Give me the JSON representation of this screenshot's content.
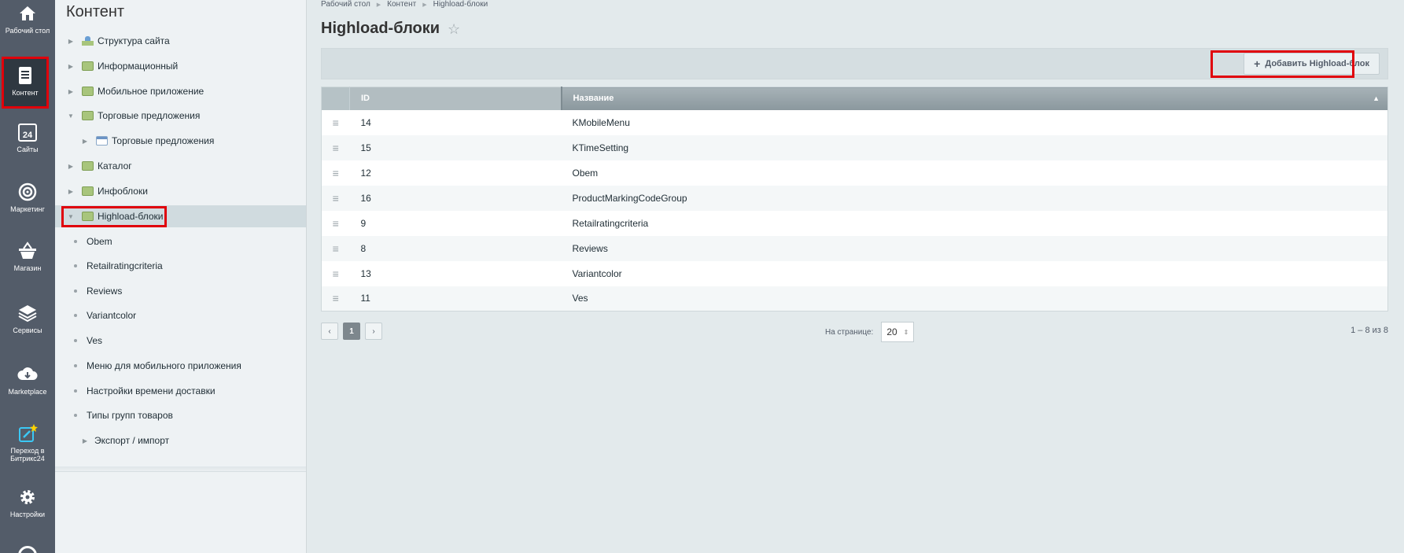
{
  "rail": [
    {
      "label": "Рабочий стол",
      "icon": "home-icon"
    },
    {
      "label": "Контент",
      "icon": "document-icon",
      "active": true
    },
    {
      "label": "Сайты",
      "icon": "calendar-24-icon"
    },
    {
      "label": "Маркетинг",
      "icon": "target-icon"
    },
    {
      "label": "Магазин",
      "icon": "basket-icon"
    },
    {
      "label": "Сервисы",
      "icon": "layers-icon"
    },
    {
      "label": "Marketplace",
      "icon": "cloud-download-icon"
    },
    {
      "label": "Переход в Битрикс24",
      "icon": "edit-star-icon"
    },
    {
      "label": "Настройки",
      "icon": "gear-icon"
    }
  ],
  "tree": {
    "title": "Контент",
    "nodes": [
      {
        "label": "Структура сайта",
        "arrow": "▶",
        "icon": "structure-icon"
      },
      {
        "label": "Информационный",
        "arrow": "▶",
        "icon": "folder-icon"
      },
      {
        "label": "Мобильное приложение",
        "arrow": "▶",
        "icon": "folder-icon"
      },
      {
        "label": "Торговые предложения",
        "arrow": "▼",
        "icon": "folder-icon"
      },
      {
        "label": "Торговые предложения",
        "arrow": "▶",
        "icon": "calendar-icon"
      },
      {
        "label": "Каталог",
        "arrow": "▶",
        "icon": "folder-icon"
      },
      {
        "label": "Инфоблоки",
        "arrow": "▶",
        "icon": "folder-icon"
      },
      {
        "label": "Highload-блоки",
        "arrow": "▼",
        "icon": "folder-icon"
      },
      {
        "label": "Obem"
      },
      {
        "label": "Retailratingcriteria"
      },
      {
        "label": "Reviews"
      },
      {
        "label": "Variantcolor"
      },
      {
        "label": "Ves"
      },
      {
        "label": "Меню для мобильного приложения"
      },
      {
        "label": "Настройки времени доставки"
      },
      {
        "label": "Типы групп товаров"
      },
      {
        "label": "Экспорт / импорт",
        "arrow": "▶"
      }
    ]
  },
  "breadcrumbs": [
    "Рабочий стол",
    "Контент",
    "Highload-блоки"
  ],
  "page_title": "Highload-блоки",
  "add_button": "Добавить Highload-блок",
  "columns": {
    "id": "ID",
    "name": "Название"
  },
  "rows": [
    {
      "id": "14",
      "name": "KMobileMenu"
    },
    {
      "id": "15",
      "name": "KTimeSetting"
    },
    {
      "id": "12",
      "name": "Obem"
    },
    {
      "id": "16",
      "name": "ProductMarkingCodeGroup"
    },
    {
      "id": "9",
      "name": "Retailratingcriteria"
    },
    {
      "id": "8",
      "name": "Reviews"
    },
    {
      "id": "13",
      "name": "Variantcolor"
    },
    {
      "id": "11",
      "name": "Ves"
    }
  ],
  "pager": {
    "prev": "‹",
    "current": "1",
    "next": "›"
  },
  "per_page": {
    "label": "На странице:",
    "value": "20"
  },
  "counter": "1 – 8 из 8"
}
